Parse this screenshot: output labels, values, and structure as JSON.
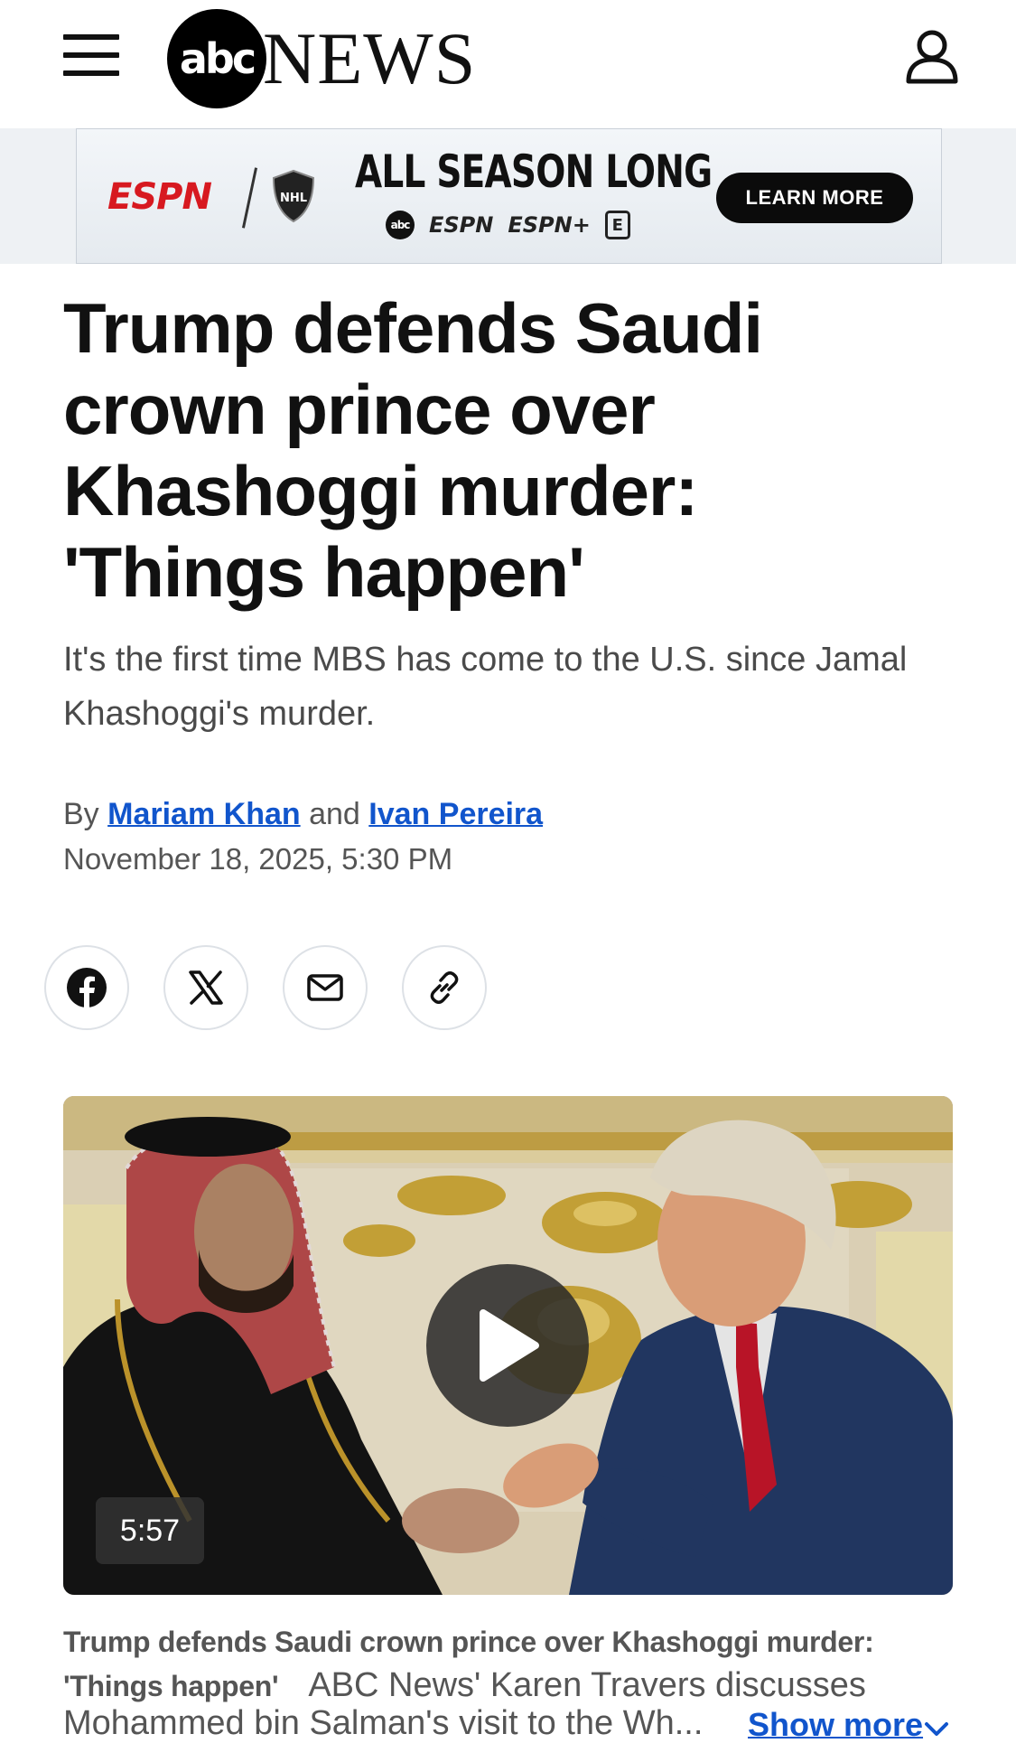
{
  "header": {
    "logo_abc": "abc",
    "logo_news": "NEWS",
    "menu_icon": "hamburger-menu-icon",
    "account_icon": "user-account-icon"
  },
  "ad": {
    "espn": "ESPN",
    "nhl": "NHL",
    "headline": "ALL SEASON LONG",
    "networks": {
      "abc": "abc",
      "espn": "ESPN",
      "espn_plus": "ESPN+",
      "e": "E"
    },
    "button": "LEARN MORE",
    "brand_color": "#d71920"
  },
  "article": {
    "headline": "Trump defends Saudi crown prince over Khashoggi murder: 'Things happen'",
    "dek": "It's the first time MBS has come to the U.S. since Jamal Khashoggi's murder.",
    "byline": {
      "by": "By",
      "author1": "Mariam Khan",
      "and": "and",
      "author2": "Ivan Pereira"
    },
    "date": "November 18, 2025, 5:30 PM",
    "link_color": "#1155cc"
  },
  "share": {
    "facebook": "facebook-icon",
    "x": "x-icon",
    "email": "email-icon",
    "link": "link-icon"
  },
  "video": {
    "duration": "5:57",
    "play_icon": "play-icon",
    "caption_title": "Trump defends Saudi crown prince over Khashoggi murder: 'Things happen'",
    "caption_line_tail": "ABC News' Karen Travers discusses",
    "caption_line3": "Mohammed bin Salman's visit to the Wh...",
    "show_more": "Show more"
  }
}
